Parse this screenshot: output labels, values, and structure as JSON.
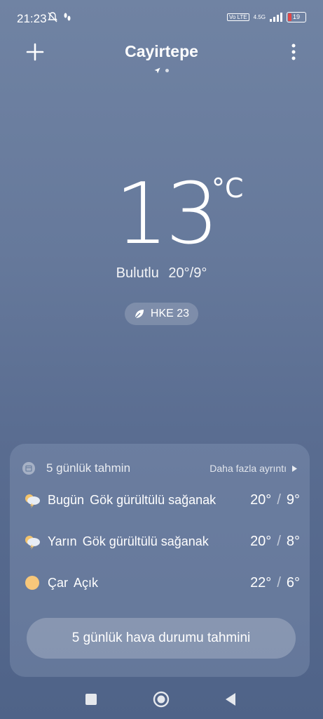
{
  "status_bar": {
    "time": "21:23",
    "network_label": "4.5G",
    "volte_label": "Vo LTE",
    "battery_level": "19",
    "battery_color": "#e04848"
  },
  "header": {
    "city": "Cayirtepe",
    "add_icon": "plus-icon",
    "menu_icon": "more-vertical-icon"
  },
  "current": {
    "temperature": "13",
    "unit": "°C",
    "condition": "Bulutlu",
    "high": "20°",
    "low": "9°",
    "aqi_label": "HKE 23"
  },
  "forecast": {
    "title": "5 günlük tahmin",
    "more_link": "Daha fazla ayrıntı",
    "rows": [
      {
        "day": "Bugün",
        "desc": "Gök gürültülü sağanak",
        "high": "20°",
        "low": "9°",
        "icon": "thunderstorm-icon"
      },
      {
        "day": "Yarın",
        "desc": "Gök gürültülü sağanak",
        "high": "20°",
        "low": "8°",
        "icon": "thunderstorm-icon"
      },
      {
        "day": "Çar",
        "desc": "Açık",
        "high": "22°",
        "low": "6°",
        "icon": "sun-icon"
      }
    ],
    "button_label": "5 günlük hava durumu tahmini"
  }
}
